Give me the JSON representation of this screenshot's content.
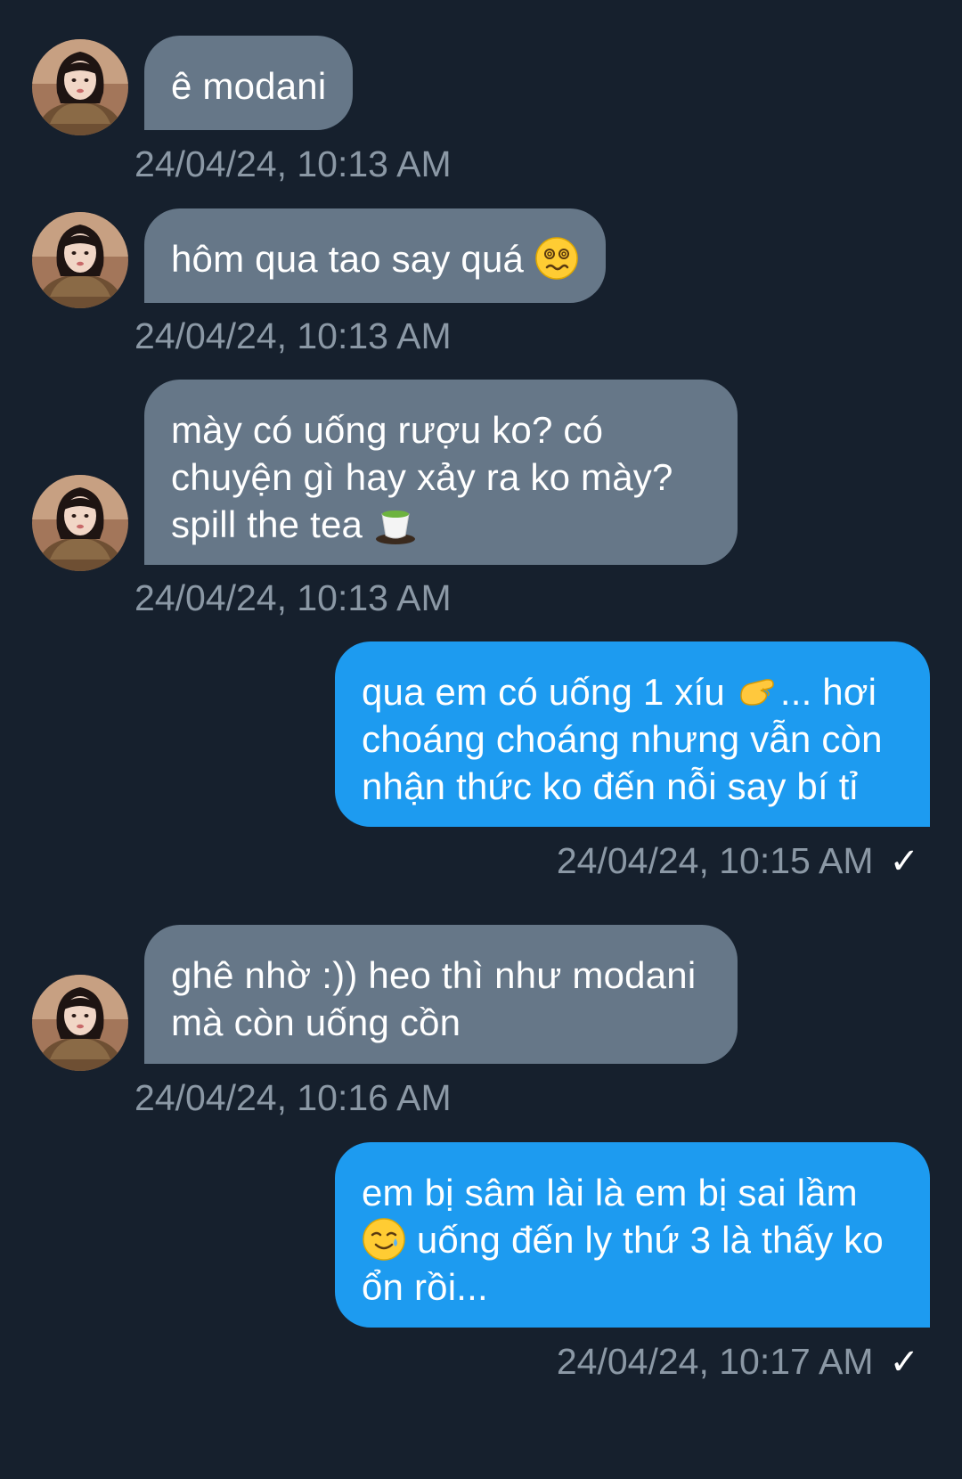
{
  "messages": [
    {
      "id": "m1",
      "direction": "incoming",
      "lines": [
        "ê modani"
      ],
      "timestamp": "24/04/24, 10:13 AM"
    },
    {
      "id": "m2",
      "direction": "incoming",
      "lines": [
        "hôm qua tao say quá"
      ],
      "emoji_after_line_1": "woozy-face-icon",
      "timestamp": "24/04/24, 10:13 AM"
    },
    {
      "id": "m3",
      "direction": "incoming",
      "lines": [
        "mày có uống rượu ko? có",
        "chuyện gì hay xảy ra ko mày?",
        "spill the tea"
      ],
      "emoji_after_line_3": "tea-cup-icon",
      "timestamp": "24/04/24, 10:13 AM"
    },
    {
      "id": "m4",
      "direction": "outgoing",
      "line1_before_emoji": "qua em có uống 1 xíu",
      "line1_emoji": "pinching-hand-icon",
      "line1_after_emoji": "... hơi",
      "lines_rest": [
        "choáng choáng nhưng vẫn còn",
        "nhận thức ko đến nỗi say bí tỉ"
      ],
      "timestamp": "24/04/24, 10:15 AM",
      "read_mark": "✓"
    },
    {
      "id": "m5",
      "direction": "incoming",
      "lines": [
        "ghê nhờ :)) heo thì như modani",
        "mà còn uống cồn"
      ],
      "timestamp": "24/04/24, 10:16 AM"
    },
    {
      "id": "m6",
      "direction": "outgoing",
      "line1": "em bị sâm lài là em bị sai lầm",
      "line2_emoji": "smiling-face-with-tear-icon",
      "line2_after_emoji": " uống đến ly thứ 3 là thấy ko",
      "line3": "ổn rồi...",
      "timestamp": "24/04/24, 10:17 AM",
      "read_mark": "✓"
    }
  ],
  "colors": {
    "background": "#16202d",
    "incoming_bubble": "#667788",
    "outgoing_bubble": "#1d9bf0",
    "timestamp": "#8b98a5",
    "text": "#ffffff"
  }
}
